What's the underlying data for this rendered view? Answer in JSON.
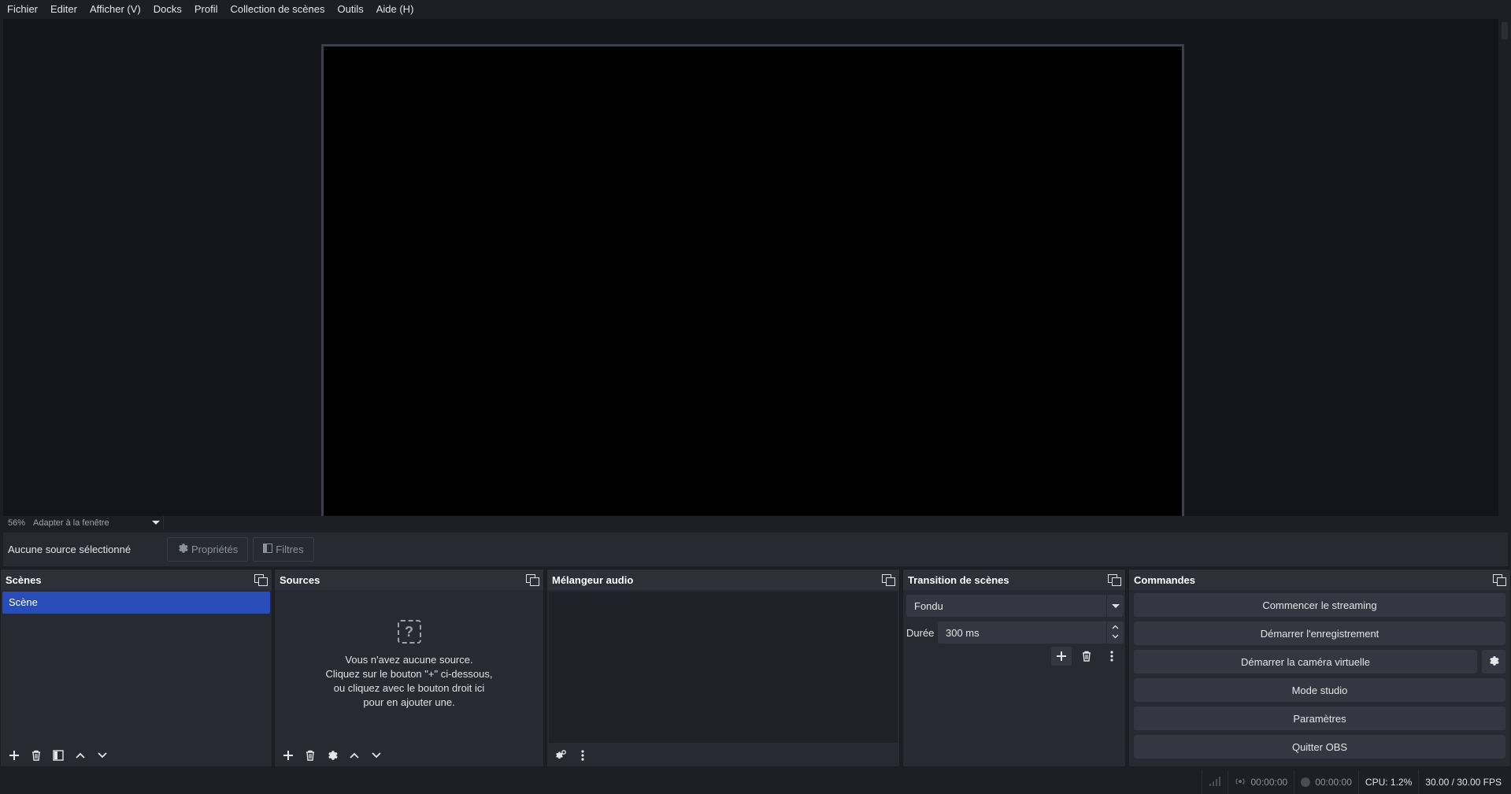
{
  "menu": [
    "Fichier",
    "Editer",
    "Afficher (V)",
    "Docks",
    "Profil",
    "Collection de scènes",
    "Outils",
    "Aide (H)"
  ],
  "zoom": {
    "percent": "56%",
    "mode": "Adapter à la fenêtre"
  },
  "context": {
    "no_source": "Aucune source sélectionné",
    "properties": "Propriétés",
    "filters": "Filtres"
  },
  "docks": {
    "scenes": {
      "title": "Scènes",
      "items": [
        "Scène"
      ]
    },
    "sources": {
      "title": "Sources",
      "empty_line1": "Vous n'avez aucune source.",
      "empty_line2": "Cliquez sur le bouton \"+\" ci-dessous,",
      "empty_line3": "ou cliquez avec le bouton droit ici",
      "empty_line4": "pour en ajouter une."
    },
    "mixer": {
      "title": "Mélangeur audio"
    },
    "transitions": {
      "title": "Transition de scènes",
      "selected": "Fondu",
      "duration_label": "Durée",
      "duration_value": "300 ms"
    },
    "commands": {
      "title": "Commandes",
      "start_streaming": "Commencer le streaming",
      "start_recording": "Démarrer l'enregistrement",
      "start_virtualcam": "Démarrer la caméra virtuelle",
      "studio_mode": "Mode studio",
      "settings": "Paramètres",
      "quit": "Quitter OBS"
    }
  },
  "status": {
    "stream_time": "00:00:00",
    "record_time": "00:00:00",
    "cpu": "CPU: 1.2%",
    "fps": "30.00 / 30.00 FPS"
  },
  "colors": {
    "accent": "#284cb8",
    "background": "#1d1f26",
    "panel": "#272a33"
  }
}
